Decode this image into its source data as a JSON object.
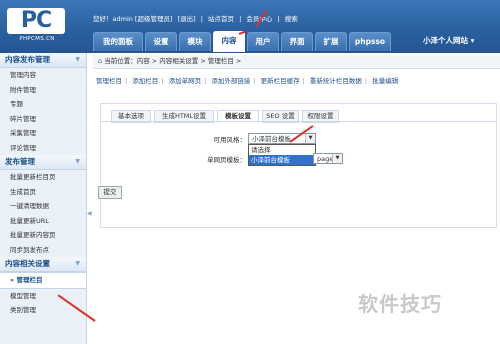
{
  "logo": {
    "main": "PC",
    "sub": "PHPCMS.CN"
  },
  "topbar": {
    "greeting": "您好！admin [超级管理员]",
    "logout": "[退出]",
    "site_home": "站点首页",
    "member_center": "会员中心",
    "search": "搜索"
  },
  "tabs": [
    {
      "label": "我的面板"
    },
    {
      "label": "设置"
    },
    {
      "label": "模块"
    },
    {
      "label": "内容"
    },
    {
      "label": "用户"
    },
    {
      "label": "界面"
    },
    {
      "label": "扩展"
    },
    {
      "label": "phpsso"
    }
  ],
  "site_name": "小泽个人网站 ▾",
  "sidebar": {
    "sections": [
      {
        "title": "内容发布管理",
        "items": [
          "管理内容",
          "附件管理",
          "专题",
          "碎片管理",
          "采集管理",
          "评论管理"
        ]
      },
      {
        "title": "发布管理",
        "items": [
          "批量更新栏目页",
          "生成首页",
          "一键清理数据",
          "批量更新URL",
          "批量更新内容页",
          "同步到发布点"
        ]
      },
      {
        "title": "内容相关设置",
        "items": [
          "管理栏目",
          "模型管理",
          "类别管理"
        ]
      }
    ]
  },
  "breadcrumb": "当前位置：内容 > 内容相关设置 > 管理栏目 >",
  "subnav": [
    "管理栏目",
    "添加栏目",
    "添加单网页",
    "添加外部链接",
    "更新栏目缓存",
    "重新统计栏目数据",
    "批量编辑"
  ],
  "panel_tabs": [
    "基本选项",
    "生成HTML设置",
    "模板设置",
    "SEO 设置",
    "权限设置"
  ],
  "form": {
    "style_label": "可用风格：",
    "style_value": "小泽前台模板",
    "single_label": "单网页模板：",
    "single_value": "page",
    "dropdown_options": [
      "请选择",
      "小泽前台模板"
    ],
    "submit": "提交"
  },
  "watermark": "软件技巧",
  "colors": {
    "header": "#2a5f9e",
    "accent": "#1c4f8d",
    "arrow": "#e0312b",
    "highlight": "#3072c9"
  }
}
